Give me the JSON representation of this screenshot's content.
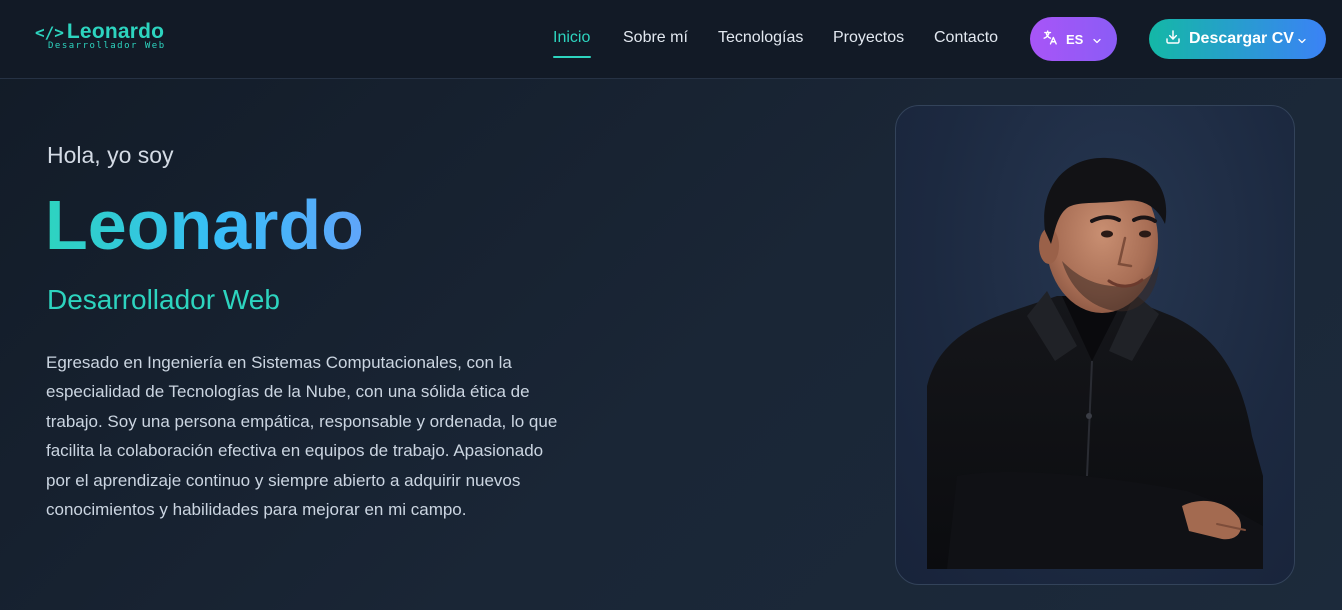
{
  "brand": {
    "code_symbol": "</>",
    "name": "Leonardo",
    "subtitle": "Desarrollador Web"
  },
  "nav": {
    "items": [
      {
        "label": "Inicio",
        "active": true
      },
      {
        "label": "Sobre mí",
        "active": false
      },
      {
        "label": "Tecnologías",
        "active": false
      },
      {
        "label": "Proyectos",
        "active": false
      },
      {
        "label": "Contacto",
        "active": false
      }
    ]
  },
  "language": {
    "icon": "translate-icon",
    "selected": "ES",
    "chevron": "chevron-down-icon"
  },
  "cv_button": {
    "icon": "download-icon",
    "label": "Descargar CV",
    "chevron": "chevron-down-icon"
  },
  "hero": {
    "greeting": "Hola, yo soy",
    "name": "Leonardo",
    "role": "Desarrollador Web",
    "description": "Egresado en Ingeniería en Sistemas Computacionales, con la especialidad de Tecnologías de la Nube, con una sólida ética de trabajo. Soy una persona empática, responsable y ordenada, lo que facilita la colaboración efectiva en equipos de trabajo. Apasionado por el aprendizaje continuo y siempre abierto a adquirir nuevos conocimientos y habilidades para mejorar en mi campo."
  },
  "colors": {
    "accent_teal": "#2dd4bf",
    "accent_blue": "#60a5fa",
    "lang_purple": "#a855f7",
    "background": "#17212f"
  }
}
